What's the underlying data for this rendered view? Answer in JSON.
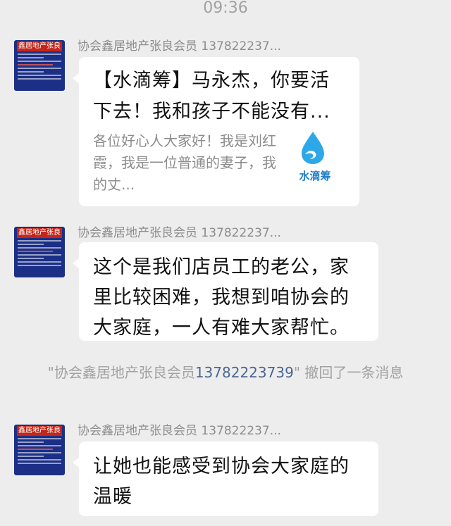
{
  "status": {
    "time": "09:36"
  },
  "brand": {
    "name": "水滴筹",
    "accent": "#1e7ec8",
    "avatar_bg": "#1c2f86",
    "avatar_title_bg": "#c4261a"
  },
  "messages": [
    {
      "sender": "协会鑫居地产张良会员 137822237...",
      "avatar_label": "鑫居地产张良",
      "type": "link",
      "title": "【水滴筹】马永杰，你要活下去！我和孩子不能没有...",
      "description": "各位好心人大家好！我是刘红霞，我是一位普通的妻子，我的丈..."
    },
    {
      "sender": "协会鑫居地产张良会员 137822237...",
      "avatar_label": "鑫居地产张良",
      "type": "text",
      "text": "这个是我们店员工的老公，家里比较困难，我想到咱协会的大家庭，一人有难大家帮忙。"
    },
    {
      "sender": "协会鑫居地产张良会员 137822237...",
      "avatar_label": "鑫居地产张良",
      "type": "text",
      "text": "让她也能感受到协会大家庭的温暖"
    }
  ],
  "recall_notice": {
    "prefix": "\"协会鑫居地产张良会员",
    "phone": "13782223739",
    "suffix": "\" 撤回了一条消息"
  }
}
